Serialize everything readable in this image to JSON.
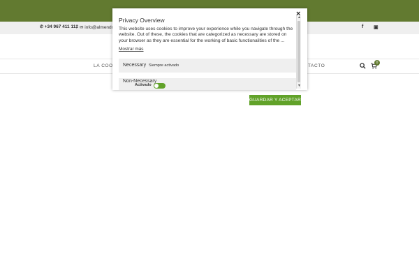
{
  "colors": {
    "brand_green": "#627a30",
    "toggle_green": "#61a229",
    "button_green": "#61a229"
  },
  "topbar": {
    "phone": "+34 967 411 112",
    "separator": "|",
    "email": "info@almendro",
    "facebook_icon": "facebook-icon",
    "instagram_icon": "instagram-icon"
  },
  "nav": {
    "left_item": "LA COOPE",
    "right_item": "ONTACTO",
    "cart_count": "0"
  },
  "modal": {
    "title": "Privacy Overview",
    "close": "×",
    "body": "This website uses cookies to improve your experience while you navigate through the website. Out of these, the cookies that are categorized as necessary are stored on your browser as they are essential for the working of basic functionalities of the ...",
    "read_more": "Mostrar más",
    "necessary": {
      "title": "Necessary",
      "status": "Siempre activado"
    },
    "non_necessary": {
      "title": "Non-Necessary",
      "toggle_label": "Activado",
      "enabled": true
    }
  },
  "save_button": "GUARDAR Y ACEPTAR"
}
